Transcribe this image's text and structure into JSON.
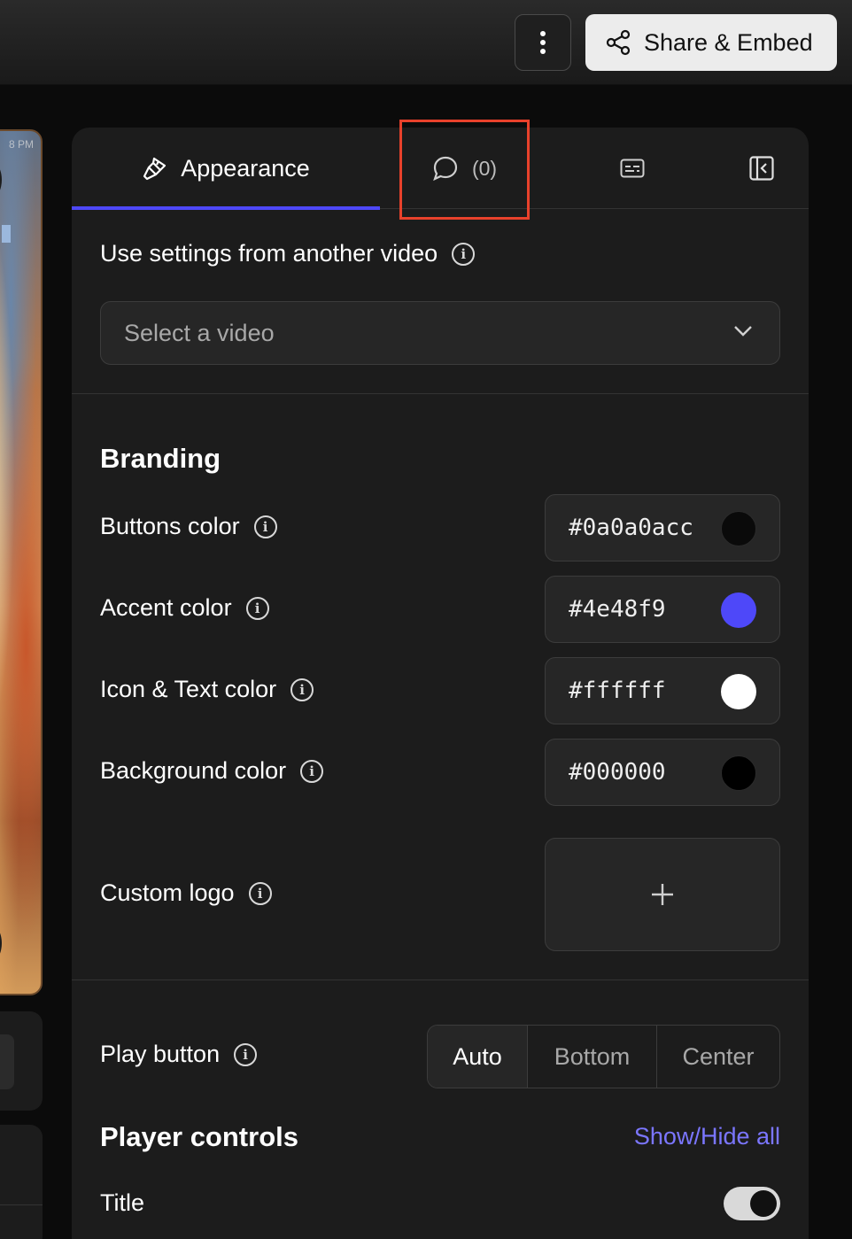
{
  "topbar": {
    "more_icon": "vertical-ellipsis-icon",
    "share_label": "Share & Embed",
    "share_icon": "share-nodes-icon"
  },
  "left": {
    "thumb_time": "8 PM"
  },
  "tabs": {
    "appearance_label": "Appearance",
    "appearance_icon": "paintbrush-icon",
    "comments_label": "(0)",
    "comments_icon": "speech-bubble-icon",
    "captions_icon": "captions-icon",
    "collapse_icon": "collapse-panel-icon",
    "active_color": "#4e48f9"
  },
  "settings_source": {
    "label": "Use settings from another video",
    "placeholder": "Select a video"
  },
  "branding": {
    "title": "Branding",
    "rows": [
      {
        "label": "Buttons color",
        "value": "#0a0a0acc",
        "swatch": "#0a0a0a"
      },
      {
        "label": "Accent color",
        "value": "#4e48f9",
        "swatch": "#4e48f9"
      },
      {
        "label": "Icon & Text color",
        "value": "#ffffff",
        "swatch": "#ffffff"
      },
      {
        "label": "Background color",
        "value": "#000000",
        "swatch": "#000000"
      }
    ],
    "logo_label": "Custom logo",
    "logo_add": "+"
  },
  "play_button": {
    "label": "Play button",
    "options": [
      "Auto",
      "Bottom",
      "Center"
    ],
    "selected": "Auto"
  },
  "player_controls": {
    "title": "Player controls",
    "show_hide_label": "Show/Hide all",
    "title_toggle_label": "Title",
    "title_toggle_on": true
  },
  "colors": {
    "highlight": "#e8412b",
    "link": "#7b76ff"
  }
}
